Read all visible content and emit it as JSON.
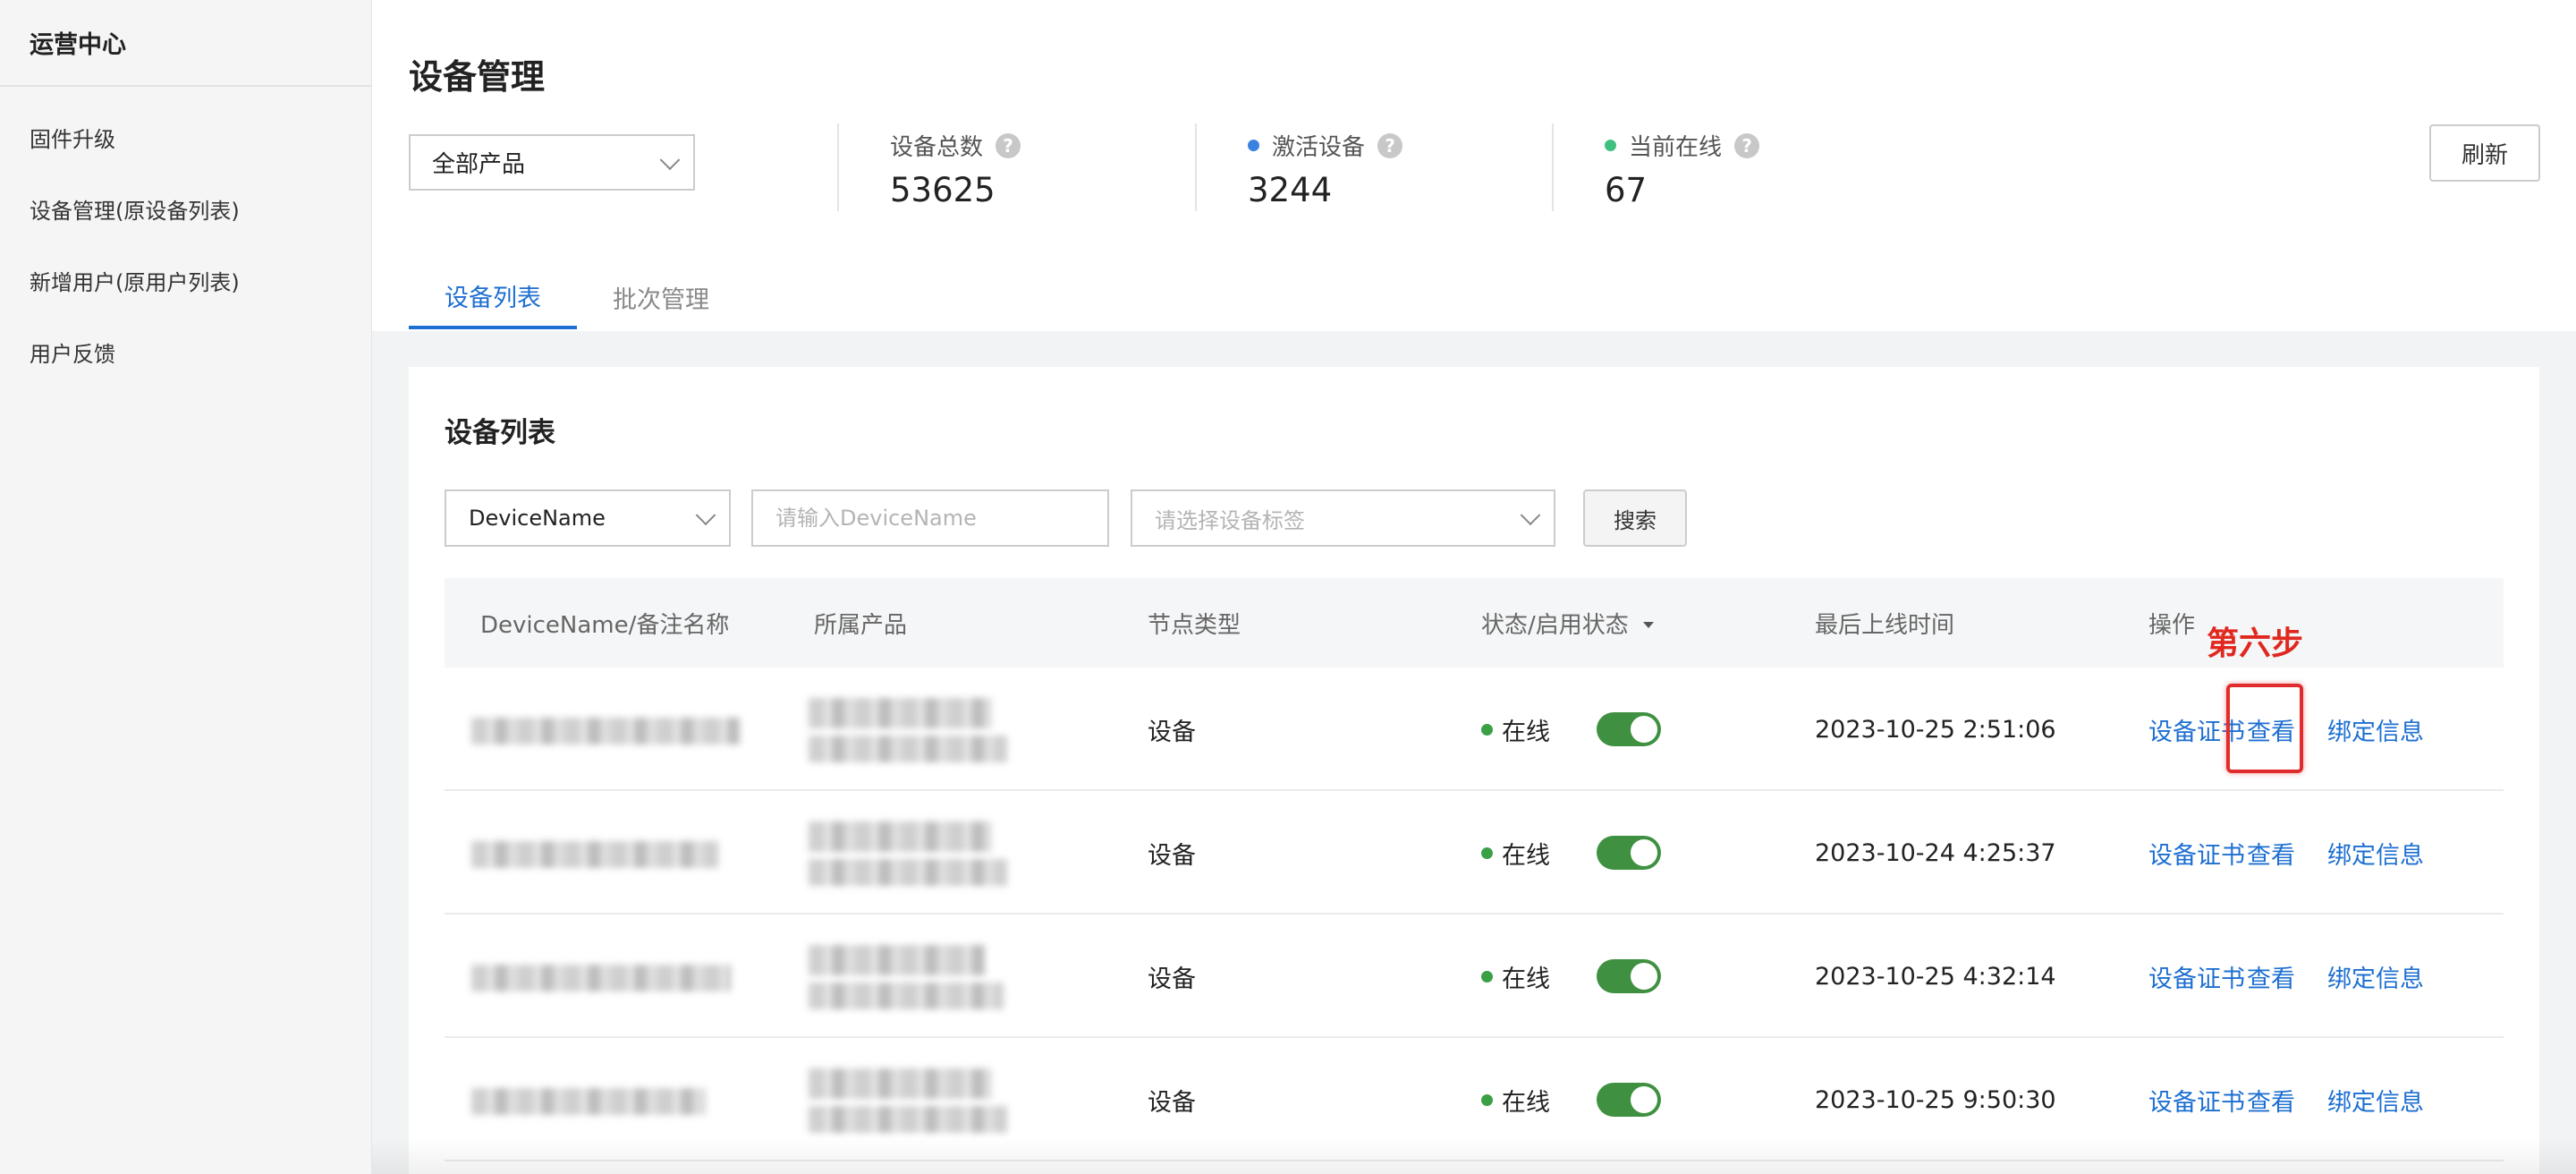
{
  "sidebar": {
    "title": "运营中心",
    "items": [
      {
        "label": "固件升级"
      },
      {
        "label": "设备管理(原设备列表)"
      },
      {
        "label": "新增用户(原用户列表)"
      },
      {
        "label": "用户反馈"
      }
    ]
  },
  "header": {
    "page_title": "设备管理",
    "product_select": "全部产品",
    "refresh_label": "刷新",
    "stats": [
      {
        "label": "设备总数",
        "value": "53625",
        "dot_color": null
      },
      {
        "label": "激活设备",
        "value": "3244",
        "dot_color": "#3b82e0"
      },
      {
        "label": "当前在线",
        "value": "67",
        "dot_color": "#40c080"
      }
    ],
    "tabs": [
      {
        "label": "设备列表",
        "active": true
      },
      {
        "label": "批次管理",
        "active": false
      }
    ]
  },
  "list": {
    "title": "设备列表",
    "filter_field": "DeviceName",
    "search_placeholder": "请输入DeviceName",
    "tag_placeholder": "请选择设备标签",
    "search_label": "搜索",
    "columns": [
      "DeviceName/备注名称",
      "所属产品",
      "节点类型",
      "状态/启用状态",
      "最后上线时间",
      "操作"
    ],
    "rows": [
      {
        "node_type": "设备",
        "status": "在线",
        "enabled": true,
        "last_online": "2023-10-25 2:51:06"
      },
      {
        "node_type": "设备",
        "status": "在线",
        "enabled": true,
        "last_online": "2023-10-24 4:25:37"
      },
      {
        "node_type": "设备",
        "status": "在线",
        "enabled": true,
        "last_online": "2023-10-25 4:32:14"
      },
      {
        "node_type": "设备",
        "status": "在线",
        "enabled": true,
        "last_online": "2023-10-25 9:50:30"
      }
    ],
    "actions": {
      "cert": "设备证书",
      "view": "查看",
      "bind": "绑定信息"
    }
  },
  "annotation": {
    "text": "第六步",
    "color": "#e0281f"
  }
}
